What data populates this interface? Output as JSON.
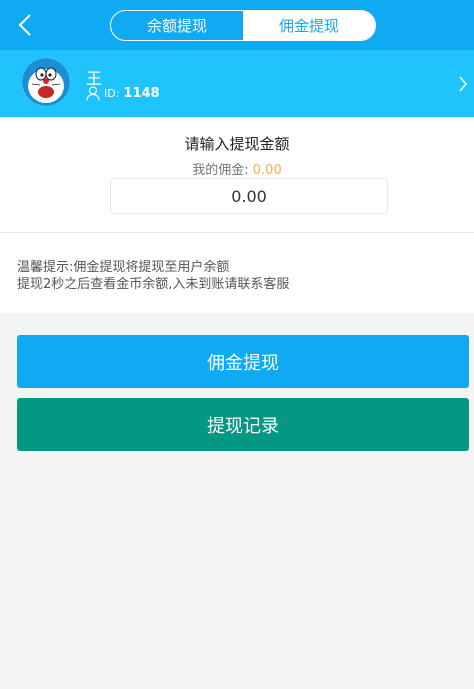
{
  "header": {
    "tabs": [
      {
        "label": "余额提现",
        "active": false
      },
      {
        "label": "佣金提现",
        "active": true
      }
    ],
    "back_icon": "chevron-left-icon",
    "colors": {
      "primary": "#10aaf3",
      "userbar": "#1ec4fb"
    }
  },
  "user": {
    "name": "王",
    "id_label": "ID:",
    "id_value": "1148",
    "avatar_icon": "doraemon-avatar"
  },
  "withdraw": {
    "prompt": "请输入提现金额",
    "balance_label": "我的佣金:",
    "balance_value": "0.00",
    "amount_value": "0.00"
  },
  "tips": {
    "line1": "温馨提示:佣金提现将提现至用户余额",
    "line2": "提现2秒之后查看金币余额,入未到账请联系客服"
  },
  "buttons": {
    "withdraw_label": "佣金提现",
    "records_label": "提现记录",
    "withdraw_color": "#10aaf3",
    "records_color": "#049784"
  }
}
